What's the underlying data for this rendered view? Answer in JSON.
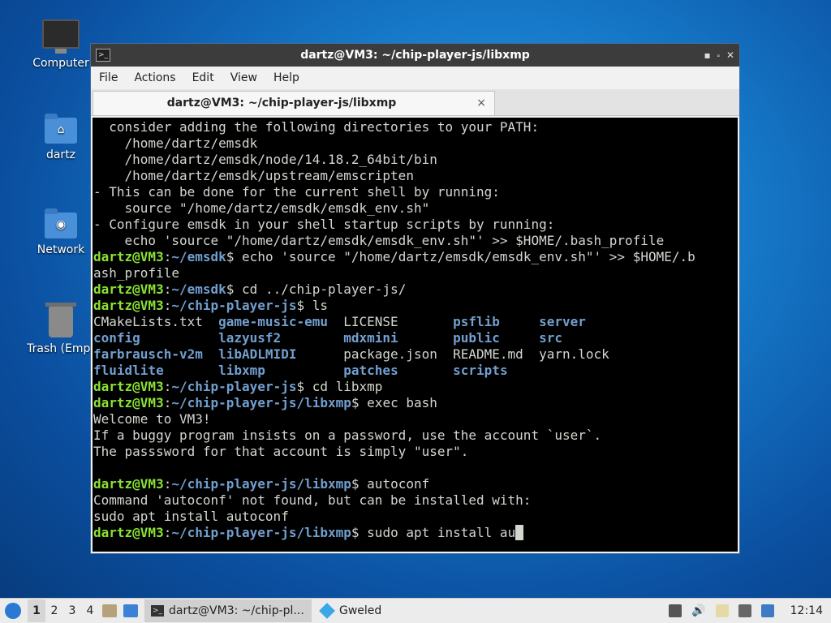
{
  "desktop": {
    "icons": [
      {
        "label": "Computer"
      },
      {
        "label": "dartz"
      },
      {
        "label": "Network"
      },
      {
        "label": "Trash (Empt"
      }
    ]
  },
  "window": {
    "title": "dartz@VM3: ~/chip-player-js/libxmp",
    "menu": [
      "File",
      "Actions",
      "Edit",
      "View",
      "Help"
    ],
    "tab_label": "dartz@VM3: ~/chip-player-js/libxmp",
    "tab_close": "×",
    "controls": {
      "minimize": "▪",
      "maximize": "⬞",
      "close": "✕"
    }
  },
  "terminal": {
    "lines": [
      {
        "text": "  consider adding the following directories to your PATH:"
      },
      {
        "text": "    /home/dartz/emsdk"
      },
      {
        "text": "    /home/dartz/emsdk/node/14.18.2_64bit/bin"
      },
      {
        "text": "    /home/dartz/emsdk/upstream/emscripten"
      },
      {
        "text": "- This can be done for the current shell by running:"
      },
      {
        "text": "    source \"/home/dartz/emsdk/emsdk_env.sh\""
      },
      {
        "text": "- Configure emsdk in your shell startup scripts by running:"
      },
      {
        "text": "    echo 'source \"/home/dartz/emsdk/emsdk_env.sh\"' >> $HOME/.bash_profile"
      },
      {
        "prompt_user": "dartz@VM3",
        "prompt_path": "~/emsdk",
        "cmd": "$ echo 'source \"/home/dartz/emsdk/emsdk_env.sh\"' >> $HOME/.b"
      },
      {
        "text": "ash_profile"
      },
      {
        "prompt_user": "dartz@VM3",
        "prompt_path": "~/emsdk",
        "cmd": "$ cd ../chip-player-js/"
      },
      {
        "prompt_user": "dartz@VM3",
        "prompt_path": "~/chip-player-js",
        "cmd": "$ ls"
      },
      {
        "ls": [
          [
            "CMakeLists.txt",
            false
          ],
          [
            "game-music-emu",
            true
          ],
          [
            "LICENSE",
            false
          ],
          [
            "psflib",
            true
          ],
          [
            "server",
            true
          ]
        ]
      },
      {
        "ls": [
          [
            "config",
            true
          ],
          [
            "lazyusf2",
            true
          ],
          [
            "mdxmini",
            true
          ],
          [
            "public",
            true
          ],
          [
            "src",
            true
          ]
        ]
      },
      {
        "ls": [
          [
            "farbrausch-v2m",
            true
          ],
          [
            "libADLMIDI",
            true
          ],
          [
            "package.json",
            false
          ],
          [
            "README.md",
            false
          ],
          [
            "yarn.lock",
            false
          ]
        ]
      },
      {
        "ls": [
          [
            "fluidlite",
            true
          ],
          [
            "libxmp",
            true
          ],
          [
            "patches",
            true
          ],
          [
            "scripts",
            true
          ]
        ]
      },
      {
        "prompt_user": "dartz@VM3",
        "prompt_path": "~/chip-player-js",
        "cmd": "$ cd libxmp"
      },
      {
        "prompt_user": "dartz@VM3",
        "prompt_path": "~/chip-player-js/libxmp",
        "cmd": "$ exec bash"
      },
      {
        "text": "Welcome to VM3!"
      },
      {
        "text": "If a buggy program insists on a password, use the account `user`."
      },
      {
        "text": "The passsword for that account is simply \"user\"."
      },
      {
        "text": ""
      },
      {
        "prompt_user": "dartz@VM3",
        "prompt_path": "~/chip-player-js/libxmp",
        "cmd": "$ autoconf"
      },
      {
        "text": "Command 'autoconf' not found, but can be installed with:"
      },
      {
        "text": "sudo apt install autoconf"
      },
      {
        "prompt_user": "dartz@VM3",
        "prompt_path": "~/chip-player-js/libxmp",
        "cmd": "$ sudo apt install au",
        "cursor": true
      }
    ]
  },
  "taskbar": {
    "workspaces": [
      "1",
      "2",
      "3",
      "4"
    ],
    "tasks": [
      {
        "label": "dartz@VM3: ~/chip-pl..."
      },
      {
        "label": "Gweled"
      }
    ],
    "clock": "12:14"
  },
  "colors": {
    "prompt_user": "#8ae234",
    "prompt_path": "#729fcf",
    "terminal_bg": "#000000"
  }
}
